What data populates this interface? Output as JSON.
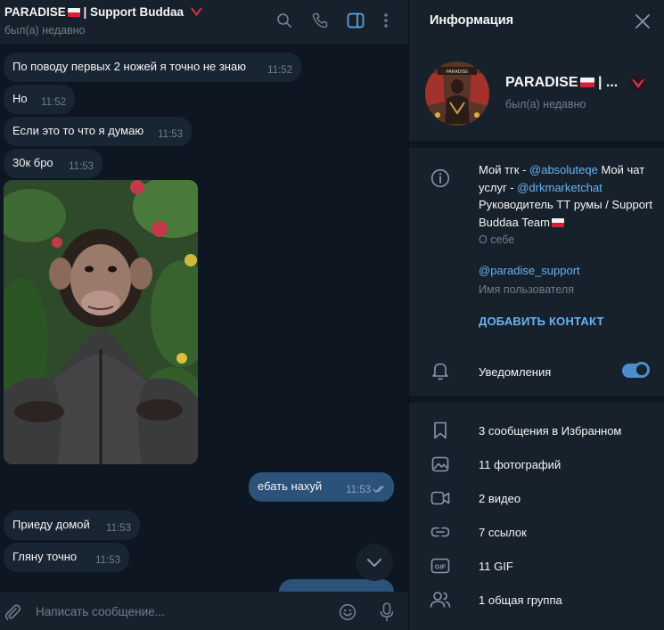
{
  "chat": {
    "title": "PARADISE",
    "title_suffix": " | Support Buddaa",
    "status": "был(а) недавно",
    "messages": [
      {
        "text": "По поводу первых 2 ножей я точно не знаю",
        "time": "11:52"
      },
      {
        "text": "Но",
        "time": "11:52"
      },
      {
        "text": "Если это то что я думаю",
        "time": "11:53"
      },
      {
        "text": "30к бро",
        "time": "11:53"
      },
      {
        "text": "ебать нахуй",
        "time": "11:53",
        "outgoing": true
      },
      {
        "text": "Приеду домой",
        "time": "11:53"
      },
      {
        "text": "Гляну точно",
        "time": "11:53"
      }
    ],
    "composer_placeholder": "Написать сообщение..."
  },
  "info": {
    "title": "Информация",
    "profile_name": "PARADISE",
    "profile_name_suffix": " | ...",
    "profile_status": "был(а) недавно",
    "bio_prefix": "Мой тгк - ",
    "bio_link1": "@absoluteqe",
    "bio_mid": " Мой чат услуг - ",
    "bio_link2": "@drkmarketchat",
    "bio_rest": " Руководитель ТТ румы / Support Buddaa Team",
    "bio_label": "О себе",
    "username": "@paradise_support",
    "username_label": "Имя пользователя",
    "add_contact": "ДОБАВИТЬ КОНТАКТ",
    "notifications": "Уведомления",
    "notifications_on": true,
    "media": [
      {
        "label": "3 сообщения в Избранном",
        "icon": "bookmark-icon"
      },
      {
        "label": "11 фотографий",
        "icon": "photo-icon"
      },
      {
        "label": "2 видео",
        "icon": "video-icon"
      },
      {
        "label": "7 ссылок",
        "icon": "link-icon"
      },
      {
        "label": "11 GIF",
        "icon": "gif-icon"
      },
      {
        "label": "1 общая группа",
        "icon": "group-icon"
      }
    ]
  },
  "colors": {
    "chat_bg": "#0e1621",
    "panel_bg": "#17212b",
    "incoming_bubble": "#182533",
    "outgoing_bubble": "#2b5278",
    "accent": "#6ab3f3",
    "muted": "#6d7f8f"
  }
}
